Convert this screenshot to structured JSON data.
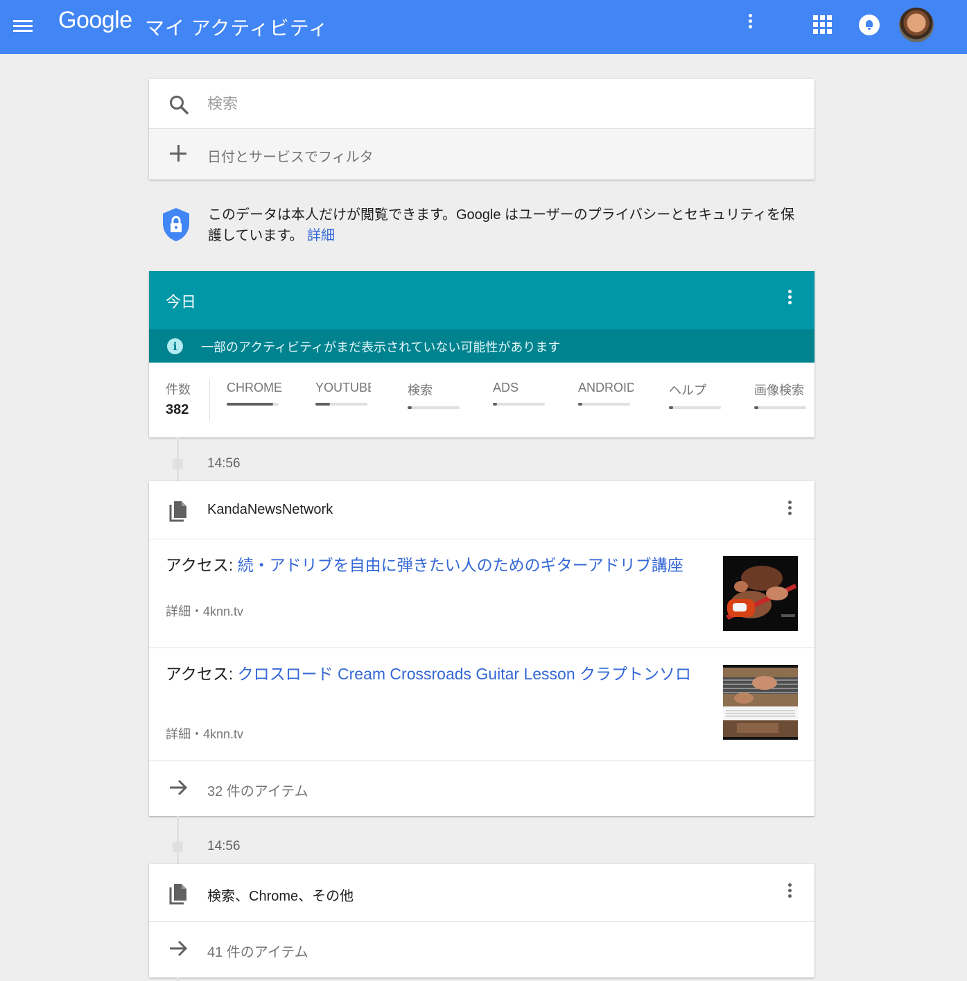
{
  "header": {
    "logo": "Google",
    "title": "マイ アクティビティ",
    "colors": {
      "bar": "#4285f4"
    }
  },
  "search": {
    "placeholder": "検索",
    "filter_label": "日付とサービスでフィルタ"
  },
  "privacy": {
    "text": "このデータは本人だけが閲覧できます。Google はユーザーのプライバシーとセキュリティを保護しています。",
    "link": "詳細"
  },
  "today": {
    "title": "今日",
    "notice": "一部のアクティビティがまだ表示されていない可能性があります",
    "count_label": "件数",
    "count": "382",
    "stats": [
      {
        "label": "CHROME",
        "fill": 0.89
      },
      {
        "label": "YOUTUBE",
        "fill": 0.28
      },
      {
        "label": "検索",
        "fill": 0.08
      },
      {
        "label": "ADS",
        "fill": 0.08
      },
      {
        "label": "ANDROID",
        "fill": 0.08
      },
      {
        "label": "ヘルプ",
        "fill": 0.08
      },
      {
        "label": "画像検索",
        "fill": 0.08
      }
    ],
    "colors": {
      "header": "#0097a7",
      "notice": "#00838f"
    }
  },
  "groups": [
    {
      "time": "14:56",
      "title": "KandaNewsNetwork",
      "items": [
        {
          "prefix": "アクセス: ",
          "link": "続・アドリブを自由に弾きたい人のためのギターアドリブ講座",
          "detail": "詳細",
          "site": "・4knn.tv"
        },
        {
          "prefix": "アクセス: ",
          "link": "クロスロード Cream Crossroads Guitar Lesson クラプトンソロ",
          "detail": "詳細",
          "site": "・4knn.tv"
        }
      ],
      "more": "32 件のアイテム"
    },
    {
      "time": "14:56",
      "title": "検索、Chrome、その他",
      "more": "41 件のアイテム"
    }
  ]
}
